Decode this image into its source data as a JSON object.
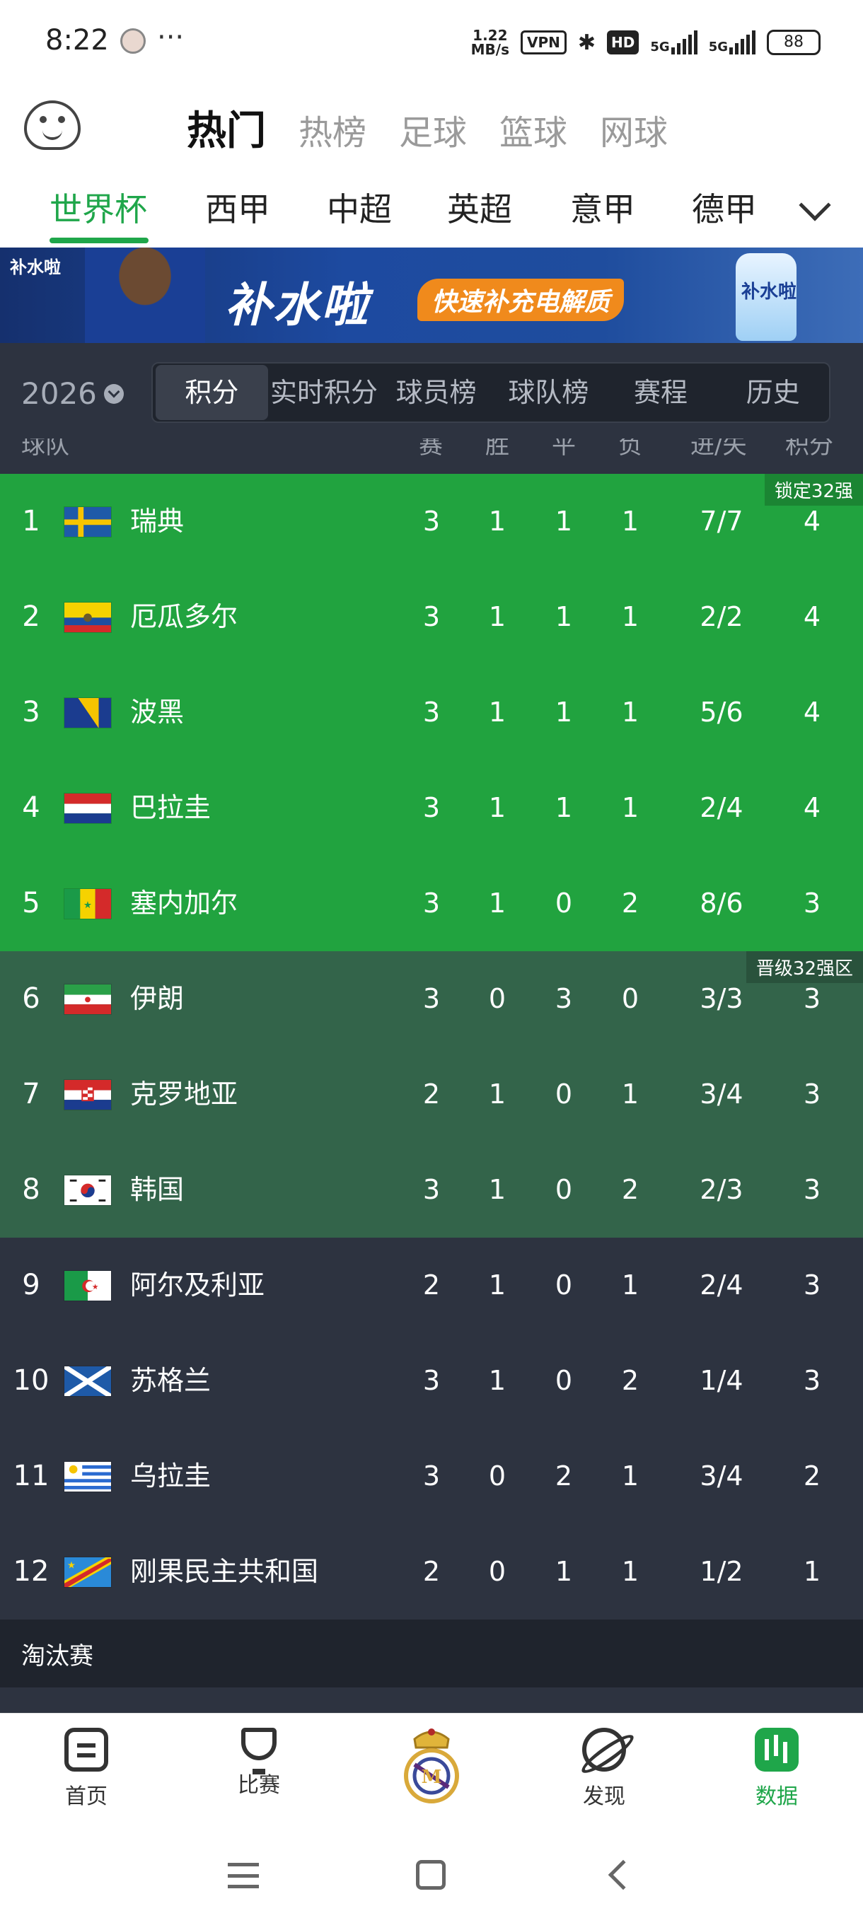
{
  "status_bar": {
    "time": "8:22",
    "dots": "···",
    "speed_top": "1.22",
    "speed_bottom": "MB/s",
    "vpn": "VPN",
    "hd": "HD",
    "sig1": "5G",
    "sig2": "5G",
    "battery": "88"
  },
  "top_nav": {
    "tabs": [
      "热门",
      "热榜",
      "足球",
      "篮球",
      "网球"
    ],
    "active_index": 0
  },
  "league_tabs": {
    "tabs": [
      "世界杯",
      "西甲",
      "中超",
      "英超",
      "意甲",
      "德甲"
    ],
    "active_index": 0
  },
  "banner": {
    "brand": "补水啦",
    "title": "补水啦",
    "slogan": "快速补充电解质",
    "bottle_label": "补水啦"
  },
  "season": "2026",
  "seg_tabs": [
    "积分",
    "实时积分",
    "球员榜",
    "球队榜",
    "赛程",
    "历史"
  ],
  "table": {
    "headers": [
      "球队",
      "赛",
      "胜",
      "平",
      "负",
      "进/失",
      "积分"
    ],
    "zone_labels": {
      "locked": "锁定32强",
      "advance": "晋级32强区"
    },
    "rows": [
      {
        "rank": "1",
        "team": "瑞典",
        "p": "3",
        "w": "1",
        "d": "1",
        "l": "1",
        "gf": "7/7",
        "pts": "4",
        "zone": "green"
      },
      {
        "rank": "2",
        "team": "厄瓜多尔",
        "p": "3",
        "w": "1",
        "d": "1",
        "l": "1",
        "gf": "2/2",
        "pts": "4",
        "zone": "green"
      },
      {
        "rank": "3",
        "team": "波黑",
        "p": "3",
        "w": "1",
        "d": "1",
        "l": "1",
        "gf": "5/6",
        "pts": "4",
        "zone": "green"
      },
      {
        "rank": "4",
        "team": "巴拉圭",
        "p": "3",
        "w": "1",
        "d": "1",
        "l": "1",
        "gf": "2/4",
        "pts": "4",
        "zone": "green"
      },
      {
        "rank": "5",
        "team": "塞内加尔",
        "p": "3",
        "w": "1",
        "d": "0",
        "l": "2",
        "gf": "8/6",
        "pts": "3",
        "zone": "green"
      },
      {
        "rank": "6",
        "team": "伊朗",
        "p": "3",
        "w": "0",
        "d": "3",
        "l": "0",
        "gf": "3/3",
        "pts": "3",
        "zone": "mid"
      },
      {
        "rank": "7",
        "team": "克罗地亚",
        "p": "2",
        "w": "1",
        "d": "0",
        "l": "1",
        "gf": "3/4",
        "pts": "3",
        "zone": "mid"
      },
      {
        "rank": "8",
        "team": "韩国",
        "p": "3",
        "w": "1",
        "d": "0",
        "l": "2",
        "gf": "2/3",
        "pts": "3",
        "zone": "mid"
      },
      {
        "rank": "9",
        "team": "阿尔及利亚",
        "p": "2",
        "w": "1",
        "d": "0",
        "l": "1",
        "gf": "2/4",
        "pts": "3",
        "zone": "dark"
      },
      {
        "rank": "10",
        "team": "苏格兰",
        "p": "3",
        "w": "1",
        "d": "0",
        "l": "2",
        "gf": "1/4",
        "pts": "3",
        "zone": "dark"
      },
      {
        "rank": "11",
        "team": "乌拉圭",
        "p": "3",
        "w": "0",
        "d": "2",
        "l": "1",
        "gf": "3/4",
        "pts": "2",
        "zone": "dark"
      },
      {
        "rank": "12",
        "team": "刚果民主共和国",
        "p": "2",
        "w": "0",
        "d": "1",
        "l": "1",
        "gf": "1/2",
        "pts": "1",
        "zone": "dark"
      }
    ]
  },
  "knockout_label": "淘汰赛",
  "bottom_nav": {
    "items": [
      "首页",
      "比赛",
      "",
      "发现",
      "数据"
    ],
    "active_index": 4
  },
  "colors": {
    "accent": "#1fa64a",
    "zone_green": "#21a33f",
    "zone_mid": "#33644a",
    "zone_dark": "#2d3340"
  }
}
